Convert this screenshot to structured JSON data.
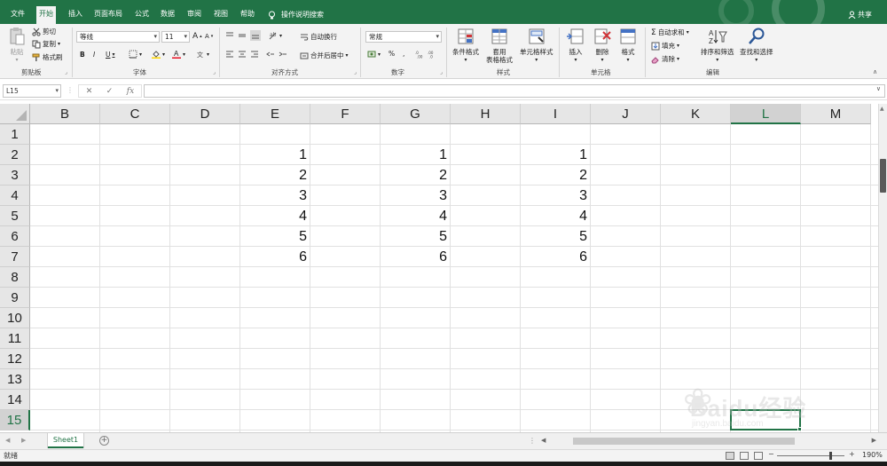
{
  "tabs": [
    {
      "label": "文件",
      "active": false
    },
    {
      "label": "开始",
      "active": true
    },
    {
      "label": "插入",
      "active": false
    },
    {
      "label": "页面布局",
      "active": false
    },
    {
      "label": "公式",
      "active": false
    },
    {
      "label": "数据",
      "active": false
    },
    {
      "label": "审阅",
      "active": false
    },
    {
      "label": "视图",
      "active": false
    },
    {
      "label": "帮助",
      "active": false
    }
  ],
  "tell_me": "操作说明搜索",
  "share": "共享",
  "ribbon": {
    "clipboard": {
      "paste": "粘贴",
      "cut": "剪切",
      "copy": "复制",
      "format_painter": "格式刷",
      "group": "剪贴板"
    },
    "font": {
      "name": "等线",
      "size": "11",
      "bold": "B",
      "italic": "I",
      "underline": "U",
      "grow": "A",
      "shrink": "A",
      "group": "字体"
    },
    "alignment": {
      "wrap": "自动换行",
      "merge": "合并后居中",
      "group": "对齐方式"
    },
    "number": {
      "format": "常规",
      "percent": "%",
      "comma": ",",
      "group": "数字"
    },
    "styles": {
      "conditional": "条件格式",
      "table_line1": "套用",
      "table_line2": "表格格式",
      "cell_styles": "单元格样式",
      "group": "样式"
    },
    "cells": {
      "insert": "插入",
      "delete": "删除",
      "format": "格式",
      "group": "单元格"
    },
    "editing": {
      "autosum": "自动求和",
      "fill": "填充",
      "clear": "清除",
      "sort": "排序和筛选",
      "find": "查找和选择",
      "group": "编辑"
    }
  },
  "formula_bar": {
    "name_box": "L15",
    "fx": "fx",
    "cancel": "✕",
    "enter": "✓",
    "content": ""
  },
  "grid": {
    "columns": [
      "B",
      "C",
      "D",
      "E",
      "F",
      "G",
      "H",
      "I",
      "J",
      "K",
      "L",
      "M"
    ],
    "rows": [
      "1",
      "2",
      "3",
      "4",
      "5",
      "6",
      "7",
      "8",
      "9",
      "10",
      "11",
      "12",
      "13",
      "14",
      "15"
    ],
    "selected_column": "L",
    "selected_row": "15",
    "cells": [
      {
        "col": "E",
        "row": 2,
        "value": "1"
      },
      {
        "col": "E",
        "row": 3,
        "value": "2"
      },
      {
        "col": "E",
        "row": 4,
        "value": "3"
      },
      {
        "col": "E",
        "row": 5,
        "value": "4"
      },
      {
        "col": "E",
        "row": 6,
        "value": "5"
      },
      {
        "col": "E",
        "row": 7,
        "value": "6"
      },
      {
        "col": "G",
        "row": 2,
        "value": "1"
      },
      {
        "col": "G",
        "row": 3,
        "value": "2"
      },
      {
        "col": "G",
        "row": 4,
        "value": "3"
      },
      {
        "col": "G",
        "row": 5,
        "value": "4"
      },
      {
        "col": "G",
        "row": 6,
        "value": "5"
      },
      {
        "col": "G",
        "row": 7,
        "value": "6"
      },
      {
        "col": "I",
        "row": 2,
        "value": "1"
      },
      {
        "col": "I",
        "row": 3,
        "value": "2"
      },
      {
        "col": "I",
        "row": 4,
        "value": "3"
      },
      {
        "col": "I",
        "row": 5,
        "value": "4"
      },
      {
        "col": "I",
        "row": 6,
        "value": "5"
      },
      {
        "col": "I",
        "row": 7,
        "value": "6"
      }
    ]
  },
  "sheet_tab": "Sheet1",
  "status": "就绪",
  "zoom": "190%",
  "watermark": {
    "text": "Baidu经验",
    "sub": "jingyan.baidu.com"
  },
  "colors": {
    "accent": "#217346",
    "tabbar": "#217346"
  }
}
